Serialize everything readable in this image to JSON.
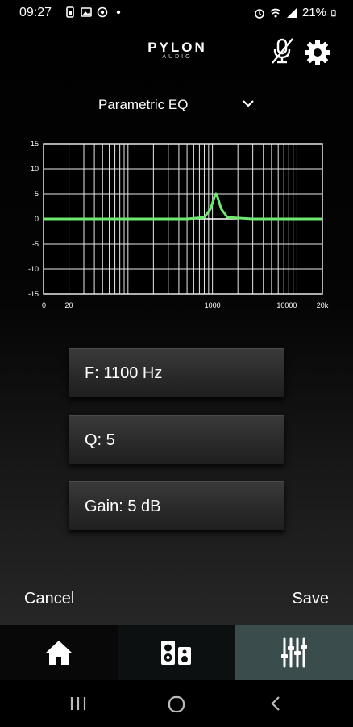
{
  "status_bar": {
    "time": "09:27",
    "battery": "21%",
    "left_icons": [
      "sim-icon",
      "image-icon",
      "notification-icon",
      "dot-icon"
    ],
    "right_icons": [
      "alarm-icon",
      "wifi-icon",
      "signal-icon",
      "battery-icon"
    ]
  },
  "header": {
    "logo_main": "PYLON",
    "logo_sub": "AUDIO",
    "mic_icon": "mic-off-icon",
    "settings_icon": "gear-icon"
  },
  "filter": {
    "selected": "Parametric EQ",
    "icon": "chevron-down-icon"
  },
  "chart_data": {
    "type": "line",
    "xscale": "log",
    "xlim": [
      10,
      20000
    ],
    "ylim": [
      -15,
      15
    ],
    "x_tick_labels": [
      "0",
      "20",
      "1000",
      "10000",
      "20k"
    ],
    "y_tick_labels": [
      "15",
      "10",
      "5",
      "0",
      "-5",
      "-10",
      "-15"
    ],
    "series": [
      {
        "color": "#6ee86e",
        "peak": {
          "frequency": 1100,
          "gain": 5,
          "q": 5
        },
        "x": [
          10,
          100,
          500,
          800,
          950,
          1050,
          1100,
          1150,
          1270,
          1500,
          3000,
          20000
        ],
        "y": [
          0,
          0,
          0,
          0.3,
          2.0,
          4.3,
          5,
          4.3,
          2.0,
          0.3,
          0,
          0
        ]
      }
    ]
  },
  "params": {
    "frequency": "F: 1100 Hz",
    "q": "Q: 5",
    "gain": "Gain: 5 dB"
  },
  "actions": {
    "cancel": "Cancel",
    "save": "Save"
  },
  "nav": {
    "items": [
      {
        "icon": "home-icon",
        "active": false
      },
      {
        "icon": "speakers-icon",
        "active": false
      },
      {
        "icon": "equalizer-icon",
        "active": true
      }
    ]
  },
  "system_nav": [
    "recents-icon",
    "home-circle-icon",
    "back-icon"
  ],
  "colors": {
    "curve": "#6ee86e",
    "active_tab": "#3b4c4c",
    "grid": "#e8e8e8",
    "plot_bg": "#000000"
  }
}
